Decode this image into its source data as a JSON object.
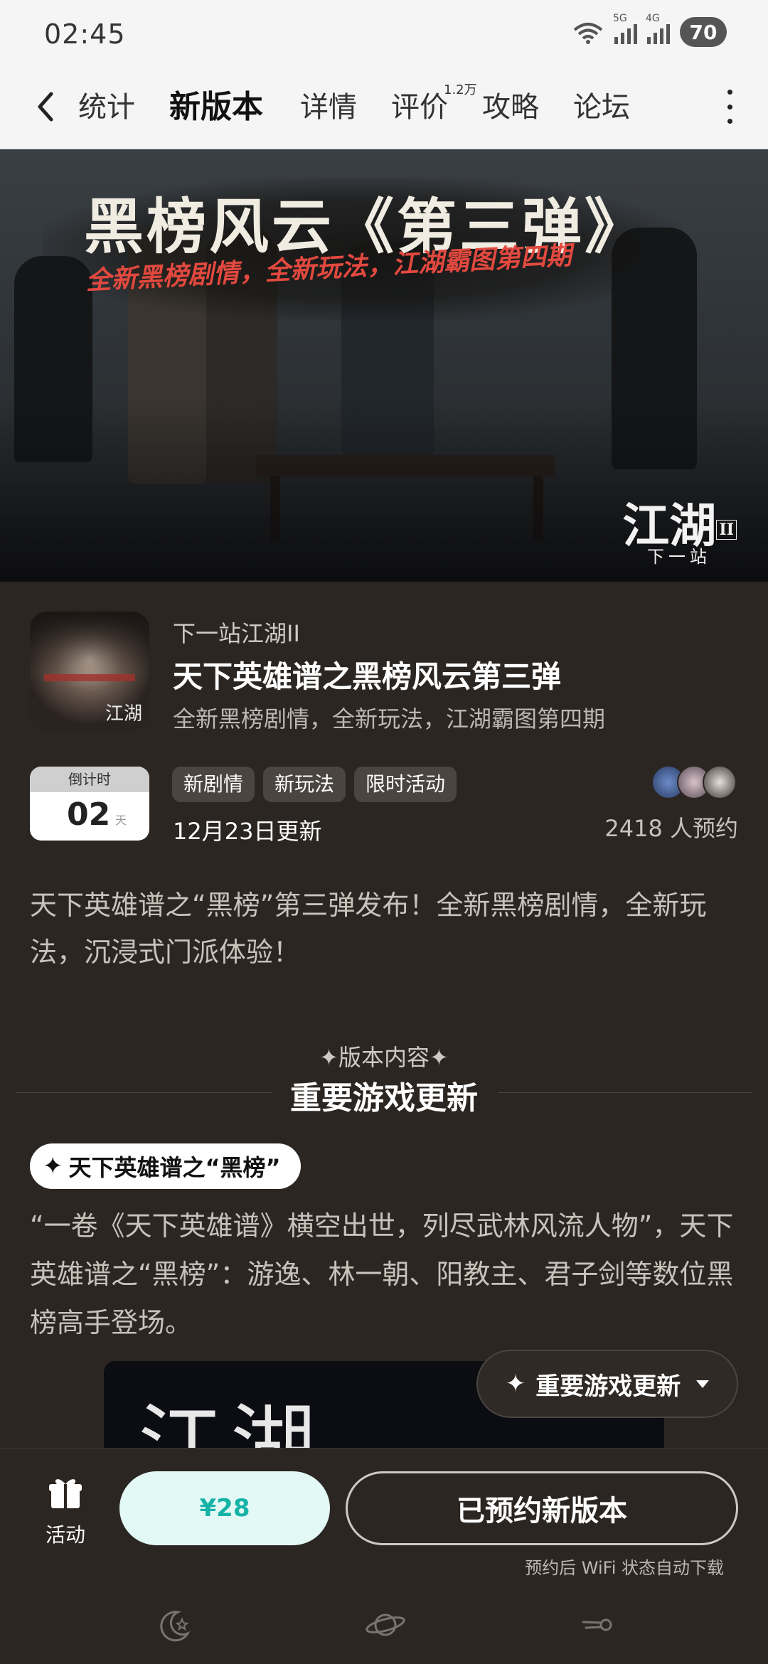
{
  "status": {
    "time": "02:45",
    "sig1": "5G",
    "sig2": "4G",
    "wifi_tag": "5",
    "battery": "70"
  },
  "tabs": [
    {
      "label": "统计",
      "active": false
    },
    {
      "label": "新版本",
      "active": true
    },
    {
      "label": "详情",
      "active": false
    },
    {
      "label": "评价",
      "active": false,
      "badge": "1.2万"
    },
    {
      "label": "攻略",
      "active": false
    },
    {
      "label": "论坛",
      "active": false
    }
  ],
  "banner": {
    "title": "黑榜风云《第三弹》",
    "subtitle": "全新黑榜剧情，全新玩法，江湖霸图第四期",
    "logo_main": "江湖",
    "logo_sub": "下一站",
    "logo_mark": "II"
  },
  "app": {
    "name": "下一站江湖II",
    "version_title": "天下英雄谱之黑榜风云第三弹",
    "version_sub": "全新黑榜剧情，全新玩法，江湖霸图第四期",
    "icon_tag": "江湖"
  },
  "countdown": {
    "label": "倒计时",
    "value": "02",
    "unit": "天"
  },
  "tags": [
    "新剧情",
    "新玩法",
    "限时活动"
  ],
  "update_date": "12月23日更新",
  "reserve_count": "2418 人预约",
  "description": "天下英雄谱之“黑榜”第三弹发布！全新黑榜剧情，全新玩法，沉浸式门派体验！",
  "section": {
    "kicker": "✦版本内容✦",
    "title": "重要游戏更新"
  },
  "pill": {
    "star": "✦",
    "label": "天下英雄谱之“黑榜”"
  },
  "body": "“一卷《天下英雄谱》横空出世，列尽武林风流人物”，天下英雄谱之“黑榜”：游逸、林一朝、阳教主、君子剑等数位黑榜高手登场。",
  "preview": {
    "art_text": "江湖"
  },
  "float_button": {
    "star": "✦",
    "label": "重要游戏更新"
  },
  "bottom": {
    "activity_label": "活动",
    "price": "¥28",
    "reserved": "已预约新版本",
    "hint": "预约后 WiFi 状态自动下载"
  },
  "colors": {
    "accent": "#17c2b5",
    "background": "#2b2622",
    "price_bg": "#e3f9f6",
    "price_text": "#16b3a6"
  }
}
